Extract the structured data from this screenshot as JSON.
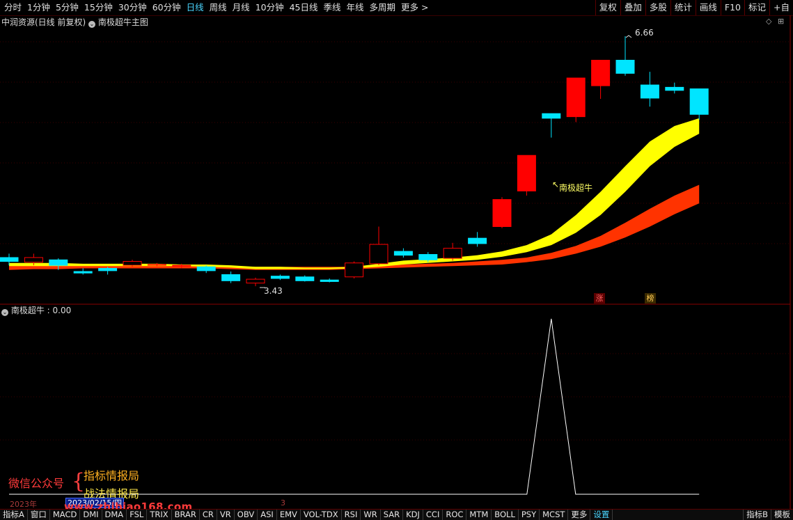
{
  "toolbar": {
    "periods": [
      "分时",
      "1分钟",
      "5分钟",
      "15分钟",
      "30分钟",
      "60分钟",
      "日线",
      "周线",
      "月线",
      "10分钟",
      "45日线",
      "季线",
      "年线",
      "多周期",
      "更多 >"
    ],
    "active_period": "日线",
    "tools": [
      "复权",
      "叠加",
      "多股",
      "统计",
      "画线",
      "F10",
      "标记",
      "+自"
    ]
  },
  "main_chart": {
    "stock_title": "中润资源(日线 前复权)",
    "indicator_title": "南极超牛主图",
    "high_label": "6.66",
    "low_label": "3.43",
    "signal_label": "南极超牛",
    "tag_zhang": "涨",
    "tag_bang": "榜"
  },
  "sub_chart": {
    "title": "南极超牛",
    "value": "0.00"
  },
  "footer": {
    "year_label": "2023年",
    "date_box": "2023/02/15/四",
    "page_num": "3"
  },
  "watermark": {
    "left_text": "微信公众号",
    "line1": "指标情报局",
    "line2": "战法情报局",
    "url": "www.zhibiao168.com"
  },
  "tabs": [
    "指标A",
    "窗口",
    "MACD",
    "DMI",
    "DMA",
    "FSL",
    "TRIX",
    "BRAR",
    "CR",
    "VR",
    "OBV",
    "ASI",
    "EMV",
    "VOL-TDX",
    "RSI",
    "WR",
    "SAR",
    "KDJ",
    "CCI",
    "ROC",
    "MTM",
    "BOLL",
    "PSY",
    "MCST",
    "更多",
    "设置"
  ],
  "tabs_right": [
    "指标B",
    "模板"
  ],
  "colors": {
    "up": "#ff0000",
    "down": "#00e5ff",
    "yellow_band": "#ffff00",
    "red_band": "#ff3300",
    "grid": "#5a0000"
  },
  "chart_data": [
    {
      "type": "candlestick",
      "title": "中润资源(日线 前复权)",
      "high_marker": 6.66,
      "low_marker": 3.43,
      "candles": [
        {
          "o": 3.8,
          "c": 3.75,
          "h": 3.85,
          "l": 3.7
        },
        {
          "o": 3.74,
          "c": 3.8,
          "h": 3.85,
          "l": 3.7
        },
        {
          "o": 3.77,
          "c": 3.7,
          "h": 3.79,
          "l": 3.64
        },
        {
          "o": 3.62,
          "c": 3.6,
          "h": 3.66,
          "l": 3.58
        },
        {
          "o": 3.66,
          "c": 3.63,
          "h": 3.68,
          "l": 3.58
        },
        {
          "o": 3.7,
          "c": 3.75,
          "h": 3.77,
          "l": 3.68
        },
        {
          "o": 3.71,
          "c": 3.71,
          "h": 3.73,
          "l": 3.69
        },
        {
          "o": 3.7,
          "c": 3.7,
          "h": 3.72,
          "l": 3.66
        },
        {
          "o": 3.68,
          "c": 3.63,
          "h": 3.7,
          "l": 3.6
        },
        {
          "o": 3.58,
          "c": 3.5,
          "h": 3.62,
          "l": 3.47
        },
        {
          "o": 3.47,
          "c": 3.52,
          "h": 3.54,
          "l": 3.43
        },
        {
          "o": 3.56,
          "c": 3.53,
          "h": 3.58,
          "l": 3.51
        },
        {
          "o": 3.55,
          "c": 3.5,
          "h": 3.57,
          "l": 3.49
        },
        {
          "o": 3.51,
          "c": 3.49,
          "h": 3.53,
          "l": 3.48
        },
        {
          "o": 3.55,
          "c": 3.73,
          "h": 3.75,
          "l": 3.53
        },
        {
          "o": 3.72,
          "c": 3.97,
          "h": 4.2,
          "l": 3.7
        },
        {
          "o": 3.88,
          "c": 3.83,
          "h": 3.92,
          "l": 3.8
        },
        {
          "o": 3.84,
          "c": 3.77,
          "h": 3.87,
          "l": 3.74
        },
        {
          "o": 3.79,
          "c": 3.92,
          "h": 3.99,
          "l": 3.76
        },
        {
          "o": 4.05,
          "c": 3.98,
          "h": 4.13,
          "l": 3.94
        },
        {
          "o": 4.2,
          "c": 4.55,
          "h": 4.58,
          "l": 4.18
        },
        {
          "o": 4.66,
          "c": 5.12,
          "h": 5.12,
          "l": 4.6
        },
        {
          "o": 5.66,
          "c": 5.6,
          "h": 5.66,
          "l": 5.35
        },
        {
          "o": 5.62,
          "c": 6.12,
          "h": 6.12,
          "l": 5.55
        },
        {
          "o": 6.02,
          "c": 6.35,
          "h": 6.35,
          "l": 5.85
        },
        {
          "o": 6.35,
          "c": 6.18,
          "h": 6.66,
          "l": 6.15
        },
        {
          "o": 6.03,
          "c": 5.86,
          "h": 6.2,
          "l": 5.75
        },
        {
          "o": 6.0,
          "c": 5.96,
          "h": 6.06,
          "l": 5.92
        },
        {
          "o": 5.98,
          "c": 5.65,
          "h": 5.98,
          "l": 5.58
        }
      ],
      "band_yellow": {
        "upper": [
          3.73,
          3.73,
          3.73,
          3.72,
          3.72,
          3.72,
          3.72,
          3.71,
          3.71,
          3.7,
          3.68,
          3.68,
          3.67,
          3.67,
          3.68,
          3.72,
          3.76,
          3.78,
          3.8,
          3.83,
          3.88,
          3.96,
          4.1,
          4.35,
          4.65,
          4.98,
          5.3,
          5.5,
          5.6
        ],
        "lower": [
          3.69,
          3.69,
          3.69,
          3.69,
          3.69,
          3.69,
          3.69,
          3.69,
          3.68,
          3.67,
          3.65,
          3.65,
          3.65,
          3.65,
          3.66,
          3.68,
          3.71,
          3.73,
          3.75,
          3.77,
          3.81,
          3.87,
          3.96,
          4.12,
          4.35,
          4.65,
          4.98,
          5.23,
          5.4
        ]
      },
      "band_red": {
        "upper": [
          3.7,
          3.7,
          3.7,
          3.7,
          3.7,
          3.7,
          3.7,
          3.7,
          3.69,
          3.69,
          3.68,
          3.68,
          3.68,
          3.68,
          3.68,
          3.69,
          3.71,
          3.72,
          3.73,
          3.75,
          3.77,
          3.8,
          3.86,
          3.95,
          4.08,
          4.25,
          4.43,
          4.6,
          4.74
        ],
        "lower": [
          3.64,
          3.65,
          3.65,
          3.66,
          3.66,
          3.66,
          3.66,
          3.66,
          3.66,
          3.65,
          3.64,
          3.64,
          3.64,
          3.64,
          3.65,
          3.66,
          3.67,
          3.68,
          3.69,
          3.7,
          3.71,
          3.74,
          3.78,
          3.85,
          3.94,
          4.06,
          4.2,
          4.36,
          4.5
        ]
      }
    },
    {
      "type": "line",
      "title": "南极超牛",
      "values": [
        0,
        0,
        0,
        0,
        0,
        0,
        0,
        0,
        0,
        0,
        0,
        0,
        0,
        0,
        0,
        0,
        0,
        0,
        0,
        0,
        0,
        0,
        1,
        0,
        0,
        0,
        0,
        0,
        0
      ]
    }
  ]
}
